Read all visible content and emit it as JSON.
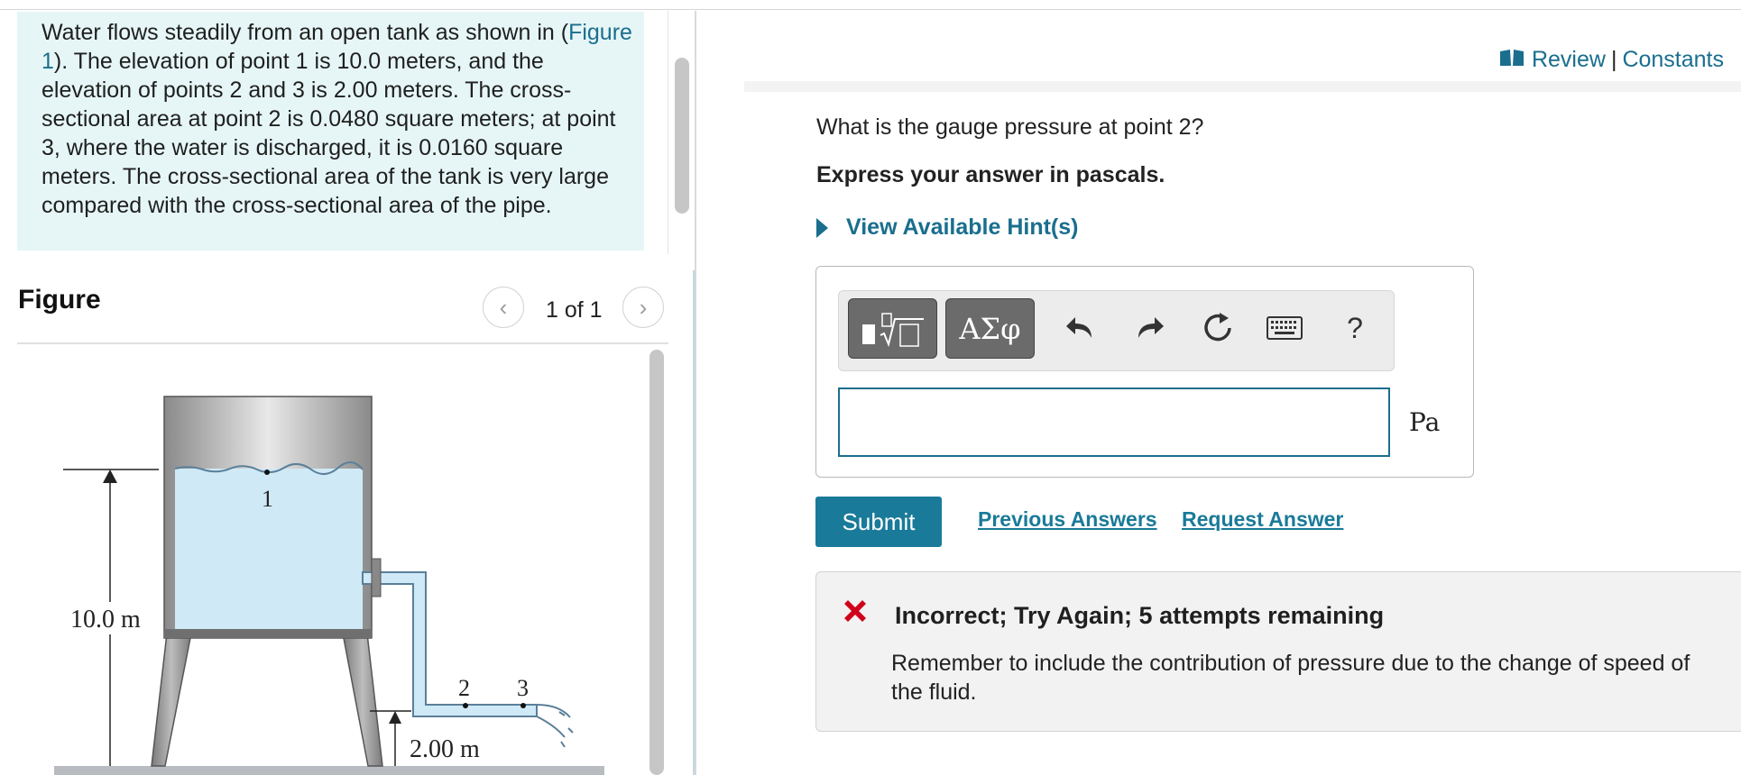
{
  "problem": {
    "text_before_link": "Water flows steadily from an open tank as shown in (",
    "figure_link": "Figure 1",
    "text_after_link": "). The elevation of point 1 is 10.0 meters, and the elevation of points 2 and 3 is 2.00 meters. The cross-sectional area at point 2 is 0.0480 square meters; at point 3, where the water is discharged, it is 0.0160 square meters. The cross-sectional area of the tank is very large compared with the cross-sectional area of the pipe."
  },
  "figure": {
    "title": "Figure",
    "page_counter": "1 of 1",
    "prev_glyph": "‹",
    "next_glyph": "›",
    "labels": {
      "point1": "1",
      "point2": "2",
      "point3": "3",
      "height_total": "10.0 m",
      "height_pipe": "2.00 m"
    }
  },
  "header": {
    "review": "Review",
    "separator": "|",
    "constants": "Constants"
  },
  "question": {
    "prompt": "What is the gauge pressure at point 2?",
    "instruction": "Express your answer in pascals.",
    "hint_label": "View Available Hint(s)"
  },
  "answer": {
    "symbols_button": "ΑΣφ",
    "help_button": "?",
    "input_value": "",
    "unit": "Pa"
  },
  "actions": {
    "submit": "Submit",
    "previous_answers": "Previous Answers",
    "request_answer": "Request Answer"
  },
  "feedback": {
    "title": "Incorrect; Try Again; 5 attempts remaining",
    "message": "Remember to include the contribution of pressure due to the change of speed of the fluid."
  },
  "colors": {
    "accent": "#1a7a99",
    "problem_background": "#e6f6f6",
    "error_red": "#d0021b",
    "water": "#cfe9f7"
  }
}
